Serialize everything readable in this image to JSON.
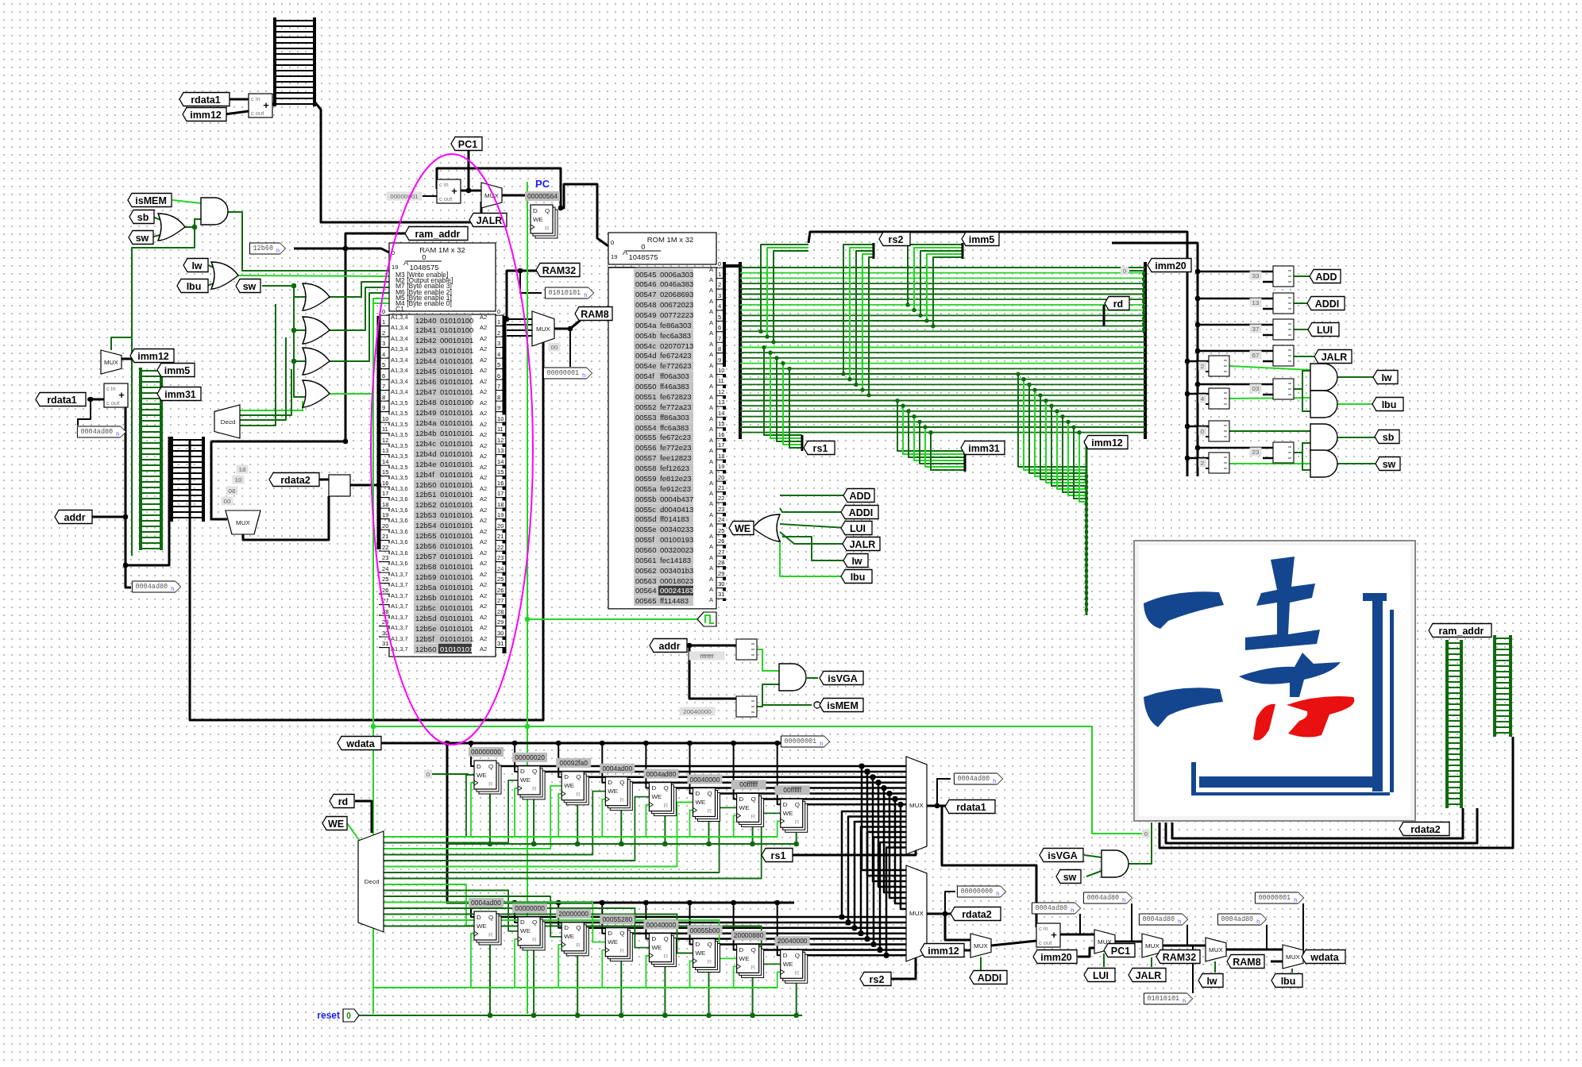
{
  "tunnels": [
    {
      "text": "rdata1"
    },
    {
      "text": "imm12"
    },
    {
      "text": "PC1"
    },
    {
      "text": "JALR"
    },
    {
      "text": "isMEM"
    },
    {
      "text": "sb"
    },
    {
      "text": "sw"
    },
    {
      "text": "ram_addr"
    },
    {
      "text": "lw"
    },
    {
      "text": "lbu"
    },
    {
      "text": "sw"
    },
    {
      "text": "RAM32"
    },
    {
      "text": "RAM8"
    },
    {
      "text": "imm12"
    },
    {
      "text": "imm5"
    },
    {
      "text": "imm31"
    },
    {
      "text": "rdata1"
    },
    {
      "text": "rdata2"
    },
    {
      "text": "addr"
    },
    {
      "text": "addr"
    },
    {
      "text": "isVGA"
    },
    {
      "text": "isMEM"
    },
    {
      "text": "wdata"
    },
    {
      "text": "rd"
    },
    {
      "text": "WE"
    },
    {
      "text": "rs1"
    },
    {
      "text": "rdata1"
    },
    {
      "text": "rdata2"
    },
    {
      "text": "rs2"
    },
    {
      "text": "imm12"
    },
    {
      "text": "ADDI"
    },
    {
      "text": "isVGA"
    },
    {
      "text": "sw"
    },
    {
      "text": "imm20"
    },
    {
      "text": "LUI"
    },
    {
      "text": "PC1"
    },
    {
      "text": "JALR"
    },
    {
      "text": "RAM32"
    },
    {
      "text": "lw"
    },
    {
      "text": "RAM8"
    },
    {
      "text": "lbu"
    },
    {
      "text": "wdata"
    },
    {
      "text": "rdata2"
    },
    {
      "text": "ram_addr"
    },
    {
      "text": "rs2"
    },
    {
      "text": "imm5"
    },
    {
      "text": "imm20"
    },
    {
      "text": "rd"
    },
    {
      "text": "rs1"
    },
    {
      "text": "imm31"
    },
    {
      "text": "imm12"
    },
    {
      "text": "ADD"
    },
    {
      "text": "ADDI"
    },
    {
      "text": "LUI"
    },
    {
      "text": "JALR"
    },
    {
      "text": "lw"
    },
    {
      "text": "lbu"
    },
    {
      "text": "sb"
    },
    {
      "text": "sw"
    },
    {
      "text": "WE"
    },
    {
      "text": "ADD"
    },
    {
      "text": "ADDI"
    },
    {
      "text": "LUI"
    },
    {
      "text": "JALR"
    },
    {
      "text": "lw"
    },
    {
      "text": "lbu"
    }
  ],
  "pc_label": "PC",
  "probes": [
    {
      "value": "12b60",
      "radix": "h"
    },
    {
      "value": "01010101",
      "radix": "h"
    },
    {
      "value": "00000001",
      "radix": "h"
    },
    {
      "value": "0004ad80",
      "radix": "h"
    },
    {
      "value": "0004ad80",
      "radix": "h"
    },
    {
      "value": "00000001",
      "radix": "h"
    },
    {
      "value": "0004ad80",
      "radix": "h"
    },
    {
      "value": "00000000",
      "radix": "h"
    },
    {
      "value": "0004ad80",
      "radix": "h"
    },
    {
      "value": "0004ad80",
      "radix": "h"
    },
    {
      "value": "0004ad80",
      "radix": "h"
    },
    {
      "value": "0004ad80",
      "radix": "h"
    },
    {
      "value": "00000001",
      "radix": "h"
    },
    {
      "value": "01010101",
      "radix": "h"
    }
  ],
  "constants": [
    {
      "value": "00000001"
    },
    {
      "value": "00"
    },
    {
      "value": "18"
    },
    {
      "value": "10"
    },
    {
      "value": "08"
    },
    {
      "value": "00"
    },
    {
      "value": "0"
    },
    {
      "value": "0"
    },
    {
      "value": "33"
    },
    {
      "value": "13"
    },
    {
      "value": "37"
    },
    {
      "value": "67"
    },
    {
      "value": "03"
    },
    {
      "value": "23"
    },
    {
      "value": "2"
    },
    {
      "value": "4"
    },
    {
      "value": "0"
    },
    {
      "value": "2"
    },
    {
      "value": "20040000"
    },
    {
      "value": "ffffffff"
    },
    {
      "value": "0"
    }
  ],
  "registers": [
    {
      "value": "00000564",
      "pins": [
        "D",
        "Q",
        "WE",
        "R"
      ]
    },
    {
      "value": "00000000",
      "pins": [
        "D",
        "Q",
        "WE",
        "R"
      ]
    },
    {
      "value": "00000020",
      "pins": [
        "D",
        "Q",
        "WE",
        "R"
      ]
    },
    {
      "value": "00092fa0",
      "pins": [
        "D",
        "Q",
        "WE",
        "R"
      ]
    },
    {
      "value": "0004ad00",
      "pins": [
        "D",
        "Q",
        "WE",
        "R"
      ]
    },
    {
      "value": "0004ad80",
      "pins": [
        "D",
        "Q",
        "WE",
        "R"
      ]
    },
    {
      "value": "00040000",
      "pins": [
        "D",
        "Q",
        "WE",
        "R"
      ]
    },
    {
      "value": "00ffffff",
      "pins": [
        "D",
        "Q",
        "WE",
        "R"
      ]
    },
    {
      "value": "00ffffff",
      "pins": [
        "D",
        "Q",
        "WE",
        "R"
      ]
    },
    {
      "value": "0004ad00",
      "pins": [
        "D",
        "Q",
        "WE",
        "R"
      ]
    },
    {
      "value": "00000000",
      "pins": [
        "D",
        "Q",
        "WE",
        "R"
      ]
    },
    {
      "value": "20000000",
      "pins": [
        "D",
        "Q",
        "WE",
        "R"
      ]
    },
    {
      "value": "00055280",
      "pins": [
        "D",
        "Q",
        "WE",
        "R"
      ]
    },
    {
      "value": "00040000",
      "pins": [
        "D",
        "Q",
        "WE",
        "R"
      ]
    },
    {
      "value": "00055b00",
      "pins": [
        "D",
        "Q",
        "WE",
        "R"
      ]
    },
    {
      "value": "20000880",
      "pins": [
        "D",
        "Q",
        "WE",
        "R"
      ]
    },
    {
      "value": "20040000",
      "pins": [
        "D",
        "Q",
        "WE",
        "R"
      ]
    }
  ],
  "muxes": [
    {
      "label": "MUX"
    },
    {
      "label": "MUX"
    },
    {
      "label": "MUX"
    },
    {
      "label": "MUX"
    },
    {
      "label": "MUX"
    },
    {
      "label": "MUX"
    },
    {
      "label": "MUX"
    },
    {
      "label": "MUX"
    },
    {
      "label": "MUX"
    },
    {
      "label": "MUX"
    },
    {
      "label": "MUX"
    }
  ],
  "decoders": [
    {
      "label": "Decd"
    },
    {
      "label": "Decd"
    }
  ],
  "adders": [
    {
      "sign": "+",
      "carry_in": "c in",
      "carry_out": "c out"
    },
    {
      "sign": "+",
      "carry_in": "c in",
      "carry_out": "c out"
    },
    {
      "sign": "+",
      "carry_in": "c in",
      "carry_out": "c out"
    },
    {
      "sign": "+",
      "carry_in": "c in",
      "carry_out": "c out"
    }
  ],
  "ram": {
    "title": "RAM 1M x 32",
    "addr_symbol": "A",
    "addr_low": "0",
    "addr_high": "1048575",
    "addr_bits": [
      "0",
      "19"
    ],
    "ports": [
      "M3 [Write enable]",
      "M2 [Output enable]",
      "M7 [Byte enable 3]",
      "M6 [Byte enable 2]",
      "M5 [Byte enable 1]",
      "M4 [Byte enable 0]",
      "C1"
    ],
    "rows": [
      {
        "addr": "12b40",
        "data": "01010100",
        "selected": false
      },
      {
        "addr": "12b41",
        "data": "01010100",
        "selected": false
      },
      {
        "addr": "12b42",
        "data": "00010101",
        "selected": false
      },
      {
        "addr": "12b43",
        "data": "01010101",
        "selected": false
      },
      {
        "addr": "12b44",
        "data": "01010101",
        "selected": false
      },
      {
        "addr": "12b45",
        "data": "01010101",
        "selected": false
      },
      {
        "addr": "12b46",
        "data": "01010101",
        "selected": false
      },
      {
        "addr": "12b47",
        "data": "01010101",
        "selected": false
      },
      {
        "addr": "12b48",
        "data": "01010100",
        "selected": false
      },
      {
        "addr": "12b49",
        "data": "01010101",
        "selected": false
      },
      {
        "addr": "12b4a",
        "data": "01010101",
        "selected": false
      },
      {
        "addr": "12b4b",
        "data": "01010101",
        "selected": false
      },
      {
        "addr": "12b4c",
        "data": "01010101",
        "selected": false
      },
      {
        "addr": "12b4d",
        "data": "01010101",
        "selected": false
      },
      {
        "addr": "12b4e",
        "data": "01010101",
        "selected": false
      },
      {
        "addr": "12b4f",
        "data": "01010101",
        "selected": false
      },
      {
        "addr": "12b50",
        "data": "01010101",
        "selected": false
      },
      {
        "addr": "12b51",
        "data": "01010101",
        "selected": false
      },
      {
        "addr": "12b52",
        "data": "01010101",
        "selected": false
      },
      {
        "addr": "12b53",
        "data": "01010101",
        "selected": false
      },
      {
        "addr": "12b54",
        "data": "01010101",
        "selected": false
      },
      {
        "addr": "12b55",
        "data": "01010101",
        "selected": false
      },
      {
        "addr": "12b56",
        "data": "01010101",
        "selected": false
      },
      {
        "addr": "12b57",
        "data": "01010101",
        "selected": false
      },
      {
        "addr": "12b58",
        "data": "01010101",
        "selected": false
      },
      {
        "addr": "12b59",
        "data": "01010101",
        "selected": false
      },
      {
        "addr": "12b5a",
        "data": "01010101",
        "selected": false
      },
      {
        "addr": "12b5b",
        "data": "01010101",
        "selected": false
      },
      {
        "addr": "12b5c",
        "data": "01010101",
        "selected": false
      },
      {
        "addr": "12b5d",
        "data": "01010101",
        "selected": false
      },
      {
        "addr": "12b5e",
        "data": "01010101",
        "selected": false
      },
      {
        "addr": "12b5f",
        "data": "01010101",
        "selected": false
      },
      {
        "addr": "12b60",
        "data": "01010101",
        "selected": true
      }
    ],
    "pins": [
      {
        "in_index": "0",
        "in": "A1,3,4",
        "out": "A2",
        "out_index": "0"
      },
      {
        "in_index": "1",
        "in": "A1,3,4",
        "out": "A2",
        "out_index": "1"
      },
      {
        "in_index": "2",
        "in": "A1,3,4",
        "out": "A2",
        "out_index": "2"
      },
      {
        "in_index": "3",
        "in": "A1,3,4",
        "out": "A2",
        "out_index": "3"
      },
      {
        "in_index": "4",
        "in": "A1,3,4",
        "out": "A2",
        "out_index": "4"
      },
      {
        "in_index": "5",
        "in": "A1,3,4",
        "out": "A2",
        "out_index": "5"
      },
      {
        "in_index": "6",
        "in": "A1,3,4",
        "out": "A2",
        "out_index": "6"
      },
      {
        "in_index": "7",
        "in": "A1,3,4",
        "out": "A2",
        "out_index": "7"
      },
      {
        "in_index": "8",
        "in": "A1,3,5",
        "out": "A2",
        "out_index": "8"
      },
      {
        "in_index": "9",
        "in": "A1,3,5",
        "out": "A2",
        "out_index": "9"
      },
      {
        "in_index": "10",
        "in": "A1,3,5",
        "out": "A2",
        "out_index": "10"
      },
      {
        "in_index": "11",
        "in": "A1,3,5",
        "out": "A2",
        "out_index": "11"
      },
      {
        "in_index": "12",
        "in": "A1,3,5",
        "out": "A2",
        "out_index": "12"
      },
      {
        "in_index": "13",
        "in": "A1,3,5",
        "out": "A2",
        "out_index": "13"
      },
      {
        "in_index": "14",
        "in": "A1,3,5",
        "out": "A2",
        "out_index": "14"
      },
      {
        "in_index": "15",
        "in": "A1,3,5",
        "out": "A2",
        "out_index": "15"
      },
      {
        "in_index": "16",
        "in": "A1,3,6",
        "out": "A2",
        "out_index": "16"
      },
      {
        "in_index": "17",
        "in": "A1,3,6",
        "out": "A2",
        "out_index": "17"
      },
      {
        "in_index": "18",
        "in": "A1,3,6",
        "out": "A2",
        "out_index": "18"
      },
      {
        "in_index": "19",
        "in": "A1,3,6",
        "out": "A2",
        "out_index": "19"
      },
      {
        "in_index": "20",
        "in": "A1,3,6",
        "out": "A2",
        "out_index": "20"
      },
      {
        "in_index": "21",
        "in": "A1,3,6",
        "out": "A2",
        "out_index": "21"
      },
      {
        "in_index": "22",
        "in": "A1,3,6",
        "out": "A2",
        "out_index": "22"
      },
      {
        "in_index": "23",
        "in": "A1,3,6",
        "out": "A2",
        "out_index": "23"
      },
      {
        "in_index": "24",
        "in": "A1,3,7",
        "out": "A2",
        "out_index": "24"
      },
      {
        "in_index": "25",
        "in": "A1,3,7",
        "out": "A2",
        "out_index": "25"
      },
      {
        "in_index": "26",
        "in": "A1,3,7",
        "out": "A2",
        "out_index": "26"
      },
      {
        "in_index": "27",
        "in": "A1,3,7",
        "out": "A2",
        "out_index": "27"
      },
      {
        "in_index": "28",
        "in": "A1,3,7",
        "out": "A2",
        "out_index": "28"
      },
      {
        "in_index": "29",
        "in": "A1,3,7",
        "out": "A2",
        "out_index": "29"
      },
      {
        "in_index": "30",
        "in": "A1,3,7",
        "out": "A2",
        "out_index": "30"
      },
      {
        "in_index": "31",
        "in": "A1,3,7",
        "out": "A2",
        "out_index": "31"
      }
    ]
  },
  "rom": {
    "title": "ROM 1M x 32",
    "addr_symbol": "A",
    "addr_low": "0",
    "addr_high": "1048575",
    "addr_bits": [
      "0",
      "19"
    ],
    "rows": [
      {
        "addr": "00545",
        "data": "0006a303",
        "selected": false
      },
      {
        "addr": "00546",
        "data": "0046a383",
        "selected": false
      },
      {
        "addr": "00547",
        "data": "02068693",
        "selected": false
      },
      {
        "addr": "00548",
        "data": "00672023",
        "selected": false
      },
      {
        "addr": "00549",
        "data": "00772223",
        "selected": false
      },
      {
        "addr": "0054a",
        "data": "fe86a303",
        "selected": false
      },
      {
        "addr": "0054b",
        "data": "fec6a383",
        "selected": false
      },
      {
        "addr": "0054c",
        "data": "02070713",
        "selected": false
      },
      {
        "addr": "0054d",
        "data": "fe672423",
        "selected": false
      },
      {
        "addr": "0054e",
        "data": "fe772623",
        "selected": false
      },
      {
        "addr": "0054f",
        "data": "ff06a303",
        "selected": false
      },
      {
        "addr": "00550",
        "data": "ff46a383",
        "selected": false
      },
      {
        "addr": "00551",
        "data": "fe672823",
        "selected": false
      },
      {
        "addr": "00552",
        "data": "fe772a23",
        "selected": false
      },
      {
        "addr": "00553",
        "data": "ff86a303",
        "selected": false
      },
      {
        "addr": "00554",
        "data": "ffc6a383",
        "selected": false
      },
      {
        "addr": "00555",
        "data": "fe672c23",
        "selected": false
      },
      {
        "addr": "00556",
        "data": "fe772e23",
        "selected": false
      },
      {
        "addr": "00557",
        "data": "fee12823",
        "selected": false
      },
      {
        "addr": "00558",
        "data": "fef12623",
        "selected": false
      },
      {
        "addr": "00559",
        "data": "fe812e23",
        "selected": false
      },
      {
        "addr": "0055a",
        "data": "fe912c23",
        "selected": false
      },
      {
        "addr": "0055b",
        "data": "0004b437",
        "selected": false
      },
      {
        "addr": "0055c",
        "data": "d0040413",
        "selected": false
      },
      {
        "addr": "0055d",
        "data": "ff014183",
        "selected": false
      },
      {
        "addr": "0055e",
        "data": "00340233",
        "selected": false
      },
      {
        "addr": "0055f",
        "data": "00100193",
        "selected": false
      },
      {
        "addr": "00560",
        "data": "00320023",
        "selected": false
      },
      {
        "addr": "00561",
        "data": "fec14183",
        "selected": false
      },
      {
        "addr": "00562",
        "data": "003401b3",
        "selected": false
      },
      {
        "addr": "00563",
        "data": "00018023",
        "selected": false
      },
      {
        "addr": "00564",
        "data": "00024183",
        "selected": true
      },
      {
        "addr": "00565",
        "data": "ff114483",
        "selected": false
      }
    ],
    "pins": [
      {
        "out": "A",
        "index": "0"
      },
      {
        "out": "A",
        "index": "1"
      },
      {
        "out": "A",
        "index": "2"
      },
      {
        "out": "A",
        "index": "3"
      },
      {
        "out": "A",
        "index": "4"
      },
      {
        "out": "A",
        "index": "5"
      },
      {
        "out": "A",
        "index": "6"
      },
      {
        "out": "A",
        "index": "7"
      },
      {
        "out": "A",
        "index": "8"
      },
      {
        "out": "A",
        "index": "9"
      },
      {
        "out": "A",
        "index": "10"
      },
      {
        "out": "A",
        "index": "11"
      },
      {
        "out": "A",
        "index": "12"
      },
      {
        "out": "A",
        "index": "13"
      },
      {
        "out": "A",
        "index": "14"
      },
      {
        "out": "A",
        "index": "15"
      },
      {
        "out": "A",
        "index": "16"
      },
      {
        "out": "A",
        "index": "17"
      },
      {
        "out": "A",
        "index": "18"
      },
      {
        "out": "A",
        "index": "19"
      },
      {
        "out": "A",
        "index": "20"
      },
      {
        "out": "A",
        "index": "21"
      },
      {
        "out": "A",
        "index": "22"
      },
      {
        "out": "A",
        "index": "23"
      },
      {
        "out": "A",
        "index": "24"
      },
      {
        "out": "A",
        "index": "25"
      },
      {
        "out": "A",
        "index": "26"
      },
      {
        "out": "A",
        "index": "27"
      },
      {
        "out": "A",
        "index": "28"
      },
      {
        "out": "A",
        "index": "29"
      },
      {
        "out": "A",
        "index": "30"
      },
      {
        "out": "A",
        "index": "31"
      }
    ]
  },
  "reset_pin": {
    "label": "reset",
    "value": "0"
  }
}
